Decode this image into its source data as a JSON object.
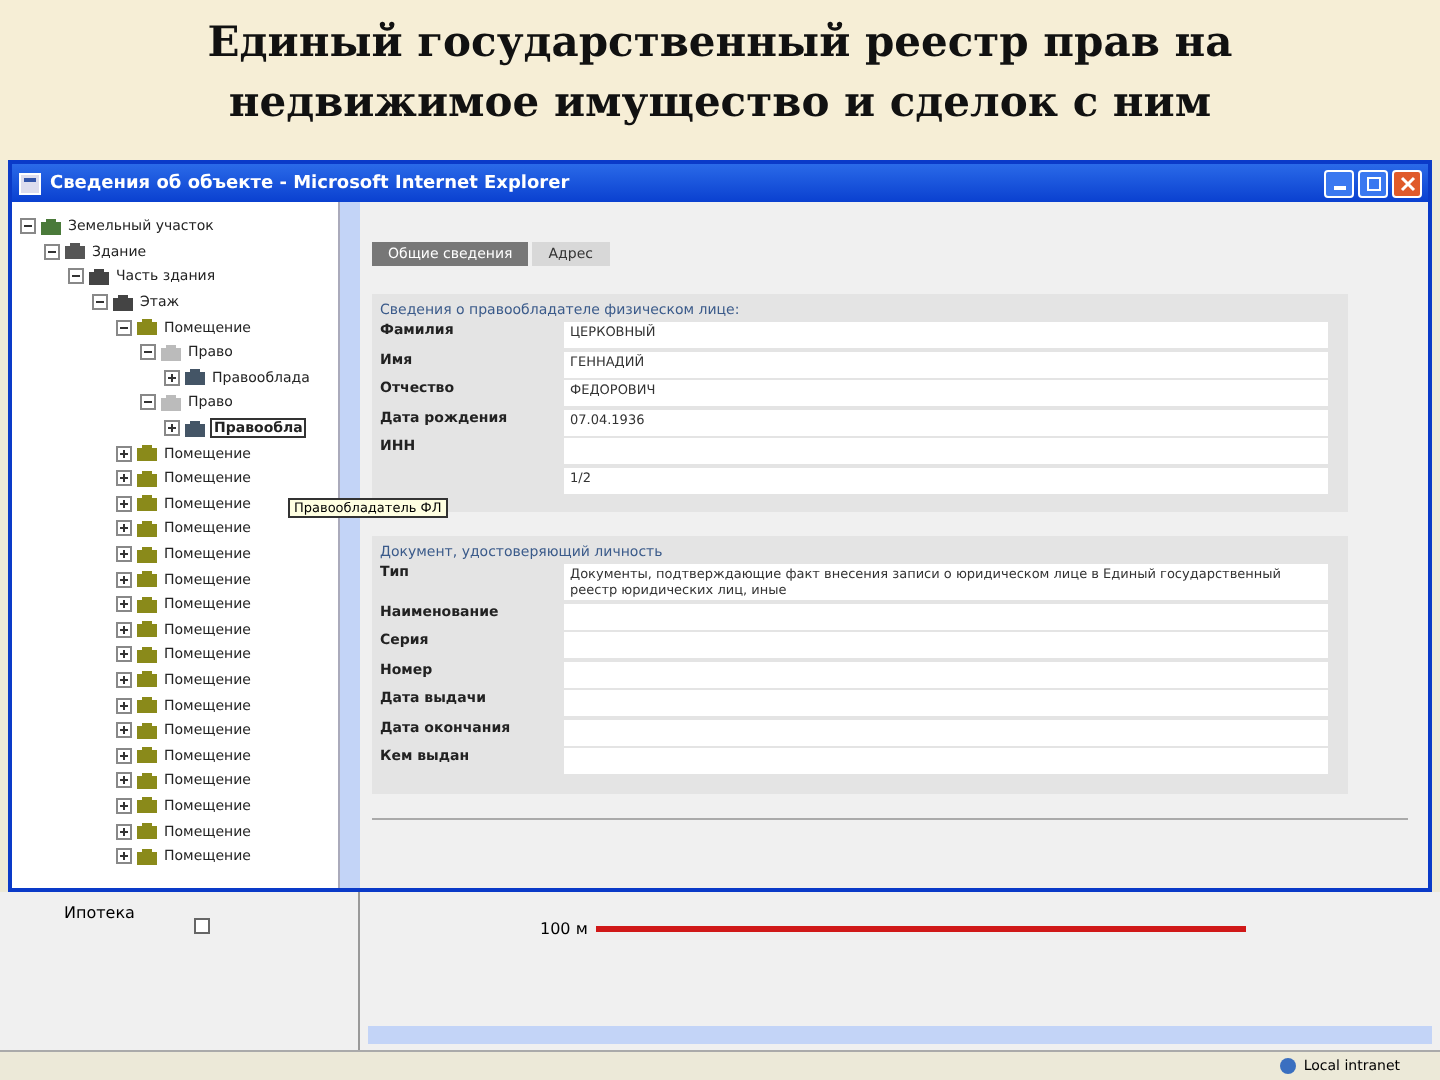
{
  "slide": {
    "title": "Единый государственный реестр прав на недвижимое имущество и сделок с ним"
  },
  "window": {
    "title": "Сведения об объекте - Microsoft Internet Explorer"
  },
  "tree": [
    {
      "label": "Земельный участок",
      "kind": "land",
      "expanded": true,
      "selected": false,
      "children": [
        {
          "label": "Здание",
          "kind": "building",
          "expanded": true,
          "selected": false,
          "children": [
            {
              "label": "Часть здания",
              "kind": "part",
              "expanded": true,
              "selected": false,
              "children": [
                {
                  "label": "Этаж",
                  "kind": "floor",
                  "expanded": true,
                  "selected": false,
                  "children": [
                    {
                      "label": "Помещение",
                      "kind": "room",
                      "expanded": true,
                      "selected": false,
                      "children": [
                        {
                          "label": "Право",
                          "kind": "right",
                          "expanded": true,
                          "selected": false,
                          "children": [
                            {
                              "label": "Правообладa",
                              "kind": "owner",
                              "expanded": false,
                              "selected": false
                            }
                          ]
                        },
                        {
                          "label": "Право",
                          "kind": "right",
                          "expanded": true,
                          "selected": false,
                          "children": [
                            {
                              "label": "Правообла",
                              "kind": "owner",
                              "expanded": false,
                              "selected": true
                            }
                          ]
                        }
                      ]
                    },
                    {
                      "label": "Помещение",
                      "kind": "room",
                      "expanded": false,
                      "selected": false
                    },
                    {
                      "label": "Помещение",
                      "kind": "room",
                      "expanded": false,
                      "selected": false
                    },
                    {
                      "label": "Помещение",
                      "kind": "room",
                      "expanded": false,
                      "selected": false
                    },
                    {
                      "label": "Помещение",
                      "kind": "room",
                      "expanded": false,
                      "selected": false
                    },
                    {
                      "label": "Помещение",
                      "kind": "room",
                      "expanded": false,
                      "selected": false
                    },
                    {
                      "label": "Помещение",
                      "kind": "room",
                      "expanded": false,
                      "selected": false
                    },
                    {
                      "label": "Помещение",
                      "kind": "room",
                      "expanded": false,
                      "selected": false
                    },
                    {
                      "label": "Помещение",
                      "kind": "room",
                      "expanded": false,
                      "selected": false
                    },
                    {
                      "label": "Помещение",
                      "kind": "room",
                      "expanded": false,
                      "selected": false
                    },
                    {
                      "label": "Помещение",
                      "kind": "room",
                      "expanded": false,
                      "selected": false
                    },
                    {
                      "label": "Помещение",
                      "kind": "room",
                      "expanded": false,
                      "selected": false
                    },
                    {
                      "label": "Помещение",
                      "kind": "room",
                      "expanded": false,
                      "selected": false
                    },
                    {
                      "label": "Помещение",
                      "kind": "room",
                      "expanded": false,
                      "selected": false
                    },
                    {
                      "label": "Помещение",
                      "kind": "room",
                      "expanded": false,
                      "selected": false
                    },
                    {
                      "label": "Помещение",
                      "kind": "room",
                      "expanded": false,
                      "selected": false
                    },
                    {
                      "label": "Помещение",
                      "kind": "room",
                      "expanded": false,
                      "selected": false
                    },
                    {
                      "label": "Помещение",
                      "kind": "room",
                      "expanded": false,
                      "selected": false
                    }
                  ]
                }
              ]
            }
          ]
        }
      ]
    }
  ],
  "tooltip": "Правообладатель ФЛ",
  "tabs": [
    {
      "label": "Общие сведения",
      "selected": true
    },
    {
      "label": "Адрес",
      "selected": false
    }
  ],
  "sections": [
    {
      "heading": "Сведения о правообладателе физическом лице:",
      "fields": [
        {
          "label": "Фамилия",
          "value": "ЦЕРКОВНЫЙ"
        },
        {
          "label": "Имя",
          "value": "ГЕННАДИЙ"
        },
        {
          "label": "Отчество",
          "value": "ФЕДОРОВИЧ"
        },
        {
          "label": "Дата рождения",
          "value": "07.04.1936"
        },
        {
          "label": "ИНН"
        },
        {
          "value": "1/2"
        }
      ]
    },
    {
      "heading": "Документ, удостоверяющий личность",
      "fields": [
        {
          "label": "Тип",
          "value": "Документы, подтверждающие факт внесения записи о юридическом лице в Единый государственный реестр юридических лиц, иные"
        },
        {
          "label": "Наименование"
        },
        {
          "label": "Серия"
        },
        {
          "label": "Номер"
        },
        {
          "label": "Дата выдачи"
        },
        {
          "label": "Дата окончания"
        },
        {
          "label": "Кем выдан"
        }
      ]
    }
  ],
  "lower_panel": {
    "layer": "Ипотека",
    "checked": false
  },
  "map": {
    "scale": "100 м"
  },
  "status_bar": {
    "zone": "Local intranet"
  }
}
